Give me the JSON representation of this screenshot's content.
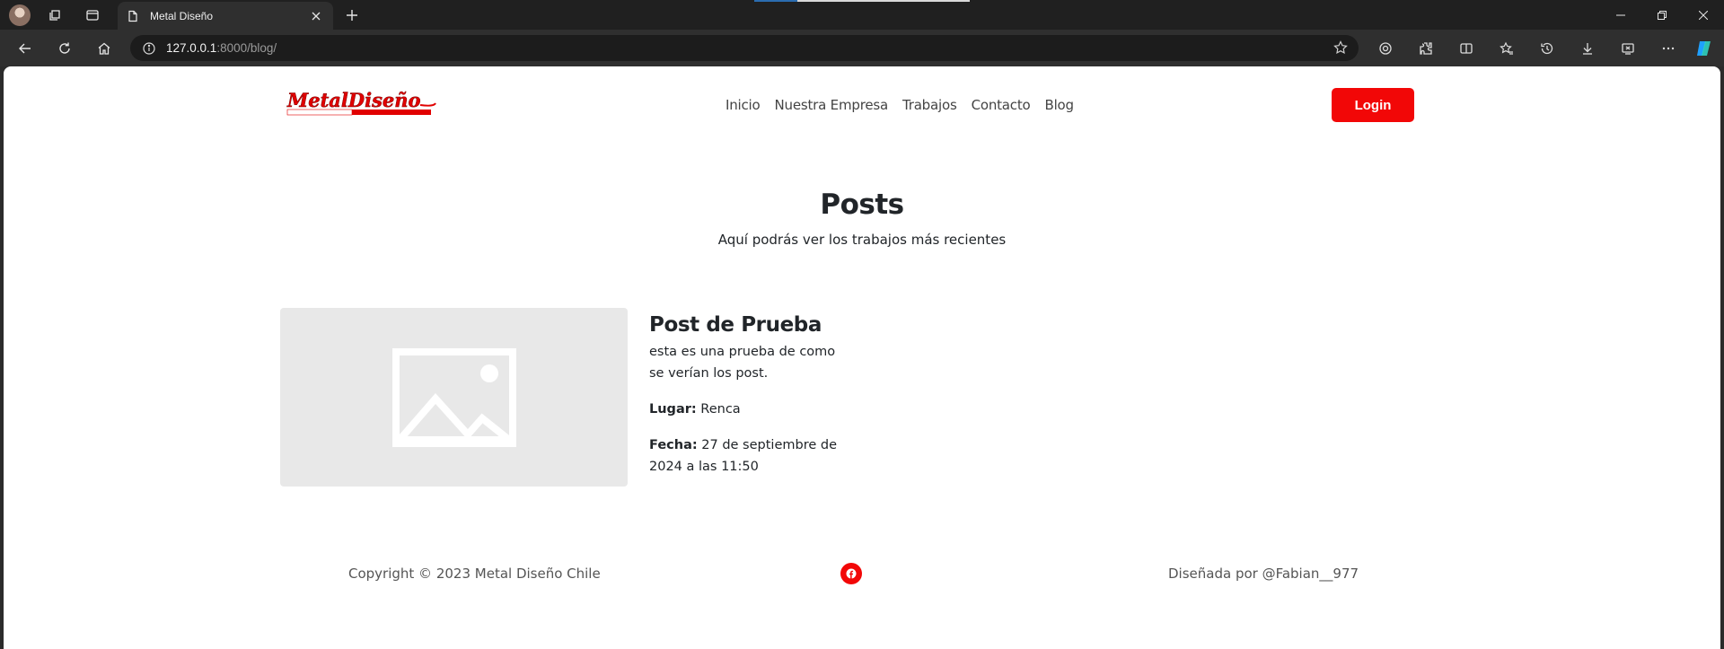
{
  "browser": {
    "tab_title": "Metal Diseño",
    "url_host": "127.0.0.1",
    "url_rest": ":8000/blog/"
  },
  "site": {
    "logo_text": "MetalDiseño",
    "nav": [
      "Inicio",
      "Nuestra Empresa",
      "Trabajos",
      "Contacto",
      "Blog"
    ],
    "login_label": "Login",
    "accent": "#f20707"
  },
  "page": {
    "title": "Posts",
    "subtitle": "Aquí podrás ver los trabajos más recientes"
  },
  "post": {
    "title": "Post de Prueba",
    "description": "esta es una prueba de como se verían los post.",
    "place_label": "Lugar:",
    "place_value": "Renca",
    "date_label": "Fecha:",
    "date_value": "27 de septiembre de 2024 a las 11:50"
  },
  "footer": {
    "copyright": "Copyright © 2023 Metal Diseño Chile",
    "designed_by": "Diseñada por @Fabian__977"
  }
}
